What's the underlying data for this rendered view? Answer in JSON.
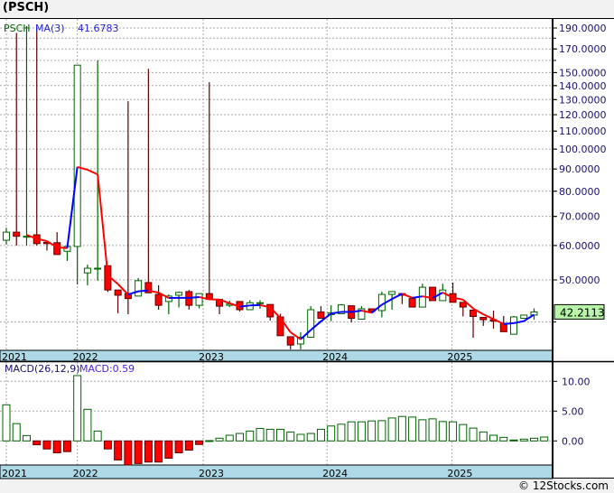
{
  "title": "(PSCH)",
  "footer": "© 12Stocks.com",
  "colors": {
    "up_border": "#006400",
    "up_fill": "#ffffff",
    "down_fill": "#ff0000",
    "down_border": "#600000",
    "ma_up": "#0000ff",
    "ma_down": "#ff0000",
    "axis_band": "#add8e6",
    "last_price_bg": "#b8f5a8"
  },
  "chart_data": [
    {
      "type": "candlestick",
      "legend": {
        "symbol": "PSCH",
        "ma_label": "MA(3)",
        "ma_value": "41.6783"
      },
      "last_price": "42.2113",
      "y_scale": "log",
      "ylim": [
        34,
        195
      ],
      "grid": true,
      "y_tick_labels": [
        "190.0000",
        "170.0000",
        "150.0000",
        "140.0000",
        "130.0000",
        "120.0000",
        "110.0000",
        "100.0000",
        "90.0000",
        "80.0000",
        "70.0000",
        "60.0000",
        "50.0000"
      ],
      "y_tick_values": [
        190,
        170,
        150,
        140,
        130,
        120,
        110,
        100,
        90,
        80,
        70,
        60,
        50
      ],
      "x_tick_labels": [
        {
          "label": "2021",
          "index": 0
        },
        {
          "label": "2022",
          "index": 7
        },
        {
          "label": "2023",
          "index": 19.4
        },
        {
          "label": "2024",
          "index": 31.6
        },
        {
          "label": "2025",
          "index": 43.9
        }
      ],
      "ohlc": [
        [
          61.7,
          65.9,
          60.3,
          64.4
        ],
        [
          64.4,
          185,
          60.0,
          63.0
        ],
        [
          63.0,
          192,
          60.0,
          63.0
        ],
        [
          63.5,
          190,
          60.0,
          60.6
        ],
        [
          61.0,
          61.1,
          58.4,
          60.6
        ],
        [
          60.9,
          64.4,
          57.2,
          57.2
        ],
        [
          58.2,
          59.7,
          55.3,
          59.7
        ],
        [
          59.7,
          156,
          48.8,
          156
        ],
        [
          51.9,
          54.2,
          48.6,
          53.2
        ],
        [
          53.0,
          160,
          49.8,
          53.2
        ],
        [
          53.9,
          53.9,
          46.9,
          47.4
        ],
        [
          47.4,
          47.4,
          41.9,
          46.1
        ],
        [
          46.5,
          128.9,
          41.7,
          45.3
        ],
        [
          45.9,
          50.5,
          45.9,
          49.8
        ],
        [
          49.3,
          153,
          46.7,
          46.7
        ],
        [
          46.3,
          48.6,
          42.7,
          43.7
        ],
        [
          44.6,
          46.3,
          41.7,
          45.9
        ],
        [
          46.1,
          47.0,
          43.2,
          46.8
        ],
        [
          47.0,
          47.4,
          42.7,
          43.7
        ],
        [
          43.7,
          46.5,
          43.0,
          46.5
        ],
        [
          46.5,
          142.5,
          45.1,
          45.1
        ],
        [
          45.1,
          45.1,
          41.7,
          43.5
        ],
        [
          43.7,
          44.8,
          43.3,
          44.0
        ],
        [
          44.6,
          44.6,
          42.3,
          42.7
        ],
        [
          42.7,
          44.9,
          42.7,
          44.3
        ],
        [
          44.3,
          44.9,
          42.9,
          44.3
        ],
        [
          43.9,
          43.9,
          40.3,
          41.1
        ],
        [
          41.1,
          41.8,
          37.2,
          37.2
        ],
        [
          37.0,
          37.0,
          34.6,
          35.4
        ],
        [
          35.6,
          37.9,
          34.6,
          36.9
        ],
        [
          36.9,
          43.5,
          36.9,
          42.7
        ],
        [
          42.2,
          43.5,
          40.8,
          40.8
        ],
        [
          41.6,
          43.7,
          40.2,
          42.0
        ],
        [
          41.8,
          44.0,
          41.8,
          43.8
        ],
        [
          43.6,
          43.6,
          39.9,
          40.8
        ],
        [
          40.6,
          43.5,
          40.6,
          42.9
        ],
        [
          42.9,
          43.0,
          42.0,
          42.3
        ],
        [
          42.5,
          47.0,
          41.0,
          46.3
        ],
        [
          46.3,
          47.0,
          42.7,
          47.0
        ],
        [
          46.5,
          46.6,
          44.0,
          46.1
        ],
        [
          45.3,
          45.3,
          43.3,
          43.3
        ],
        [
          43.3,
          49.0,
          43.3,
          48.1
        ],
        [
          48.1,
          48.1,
          44.8,
          44.8
        ],
        [
          44.8,
          49.0,
          44.8,
          47.4
        ],
        [
          46.5,
          49.3,
          44.4,
          44.4
        ],
        [
          44.4,
          44.4,
          41.2,
          43.3
        ],
        [
          42.6,
          42.6,
          36.8,
          41.2
        ],
        [
          41.0,
          41.0,
          39.2,
          40.5
        ],
        [
          40.5,
          42.5,
          38.6,
          40.2
        ],
        [
          39.7,
          41.3,
          38.0,
          38.0
        ],
        [
          37.5,
          41.3,
          37.5,
          41.1
        ],
        [
          40.8,
          41.5,
          40.8,
          41.5
        ],
        [
          41.5,
          43.0,
          40.5,
          42.2
        ]
      ]
    },
    {
      "type": "bar",
      "legend": {
        "label": "MACD(26,12,9)",
        "value_label": "MACD:0.59"
      },
      "y_tick_labels": [
        "10.00",
        "5.00",
        "0.00"
      ],
      "y_tick_values": [
        10,
        5,
        0
      ],
      "ylim": [
        -4.0,
        13.3
      ],
      "grid": true,
      "x_tick_labels": [
        {
          "label": "2021",
          "index": 0
        },
        {
          "label": "2022",
          "index": 7
        },
        {
          "label": "2023",
          "index": 19.4
        },
        {
          "label": "2024",
          "index": 31.6
        },
        {
          "label": "2025",
          "index": 43.9
        }
      ],
      "values": [
        6.06,
        2.9,
        0.9,
        -0.65,
        -1.35,
        -2.0,
        -1.8,
        10.96,
        5.3,
        1.65,
        -1.35,
        -3.2,
        -4.1,
        -3.8,
        -3.55,
        -3.55,
        -2.9,
        -2.0,
        -1.55,
        -0.6,
        0.05,
        0.45,
        0.95,
        1.25,
        1.65,
        2.1,
        1.95,
        1.95,
        1.5,
        1.1,
        1.25,
        1.95,
        2.5,
        2.8,
        3.2,
        3.2,
        3.35,
        3.4,
        3.85,
        4.1,
        4.0,
        3.55,
        3.7,
        3.25,
        3.2,
        2.75,
        2.15,
        1.5,
        0.95,
        0.6,
        0.15,
        0.3,
        0.45,
        0.65
      ]
    }
  ]
}
